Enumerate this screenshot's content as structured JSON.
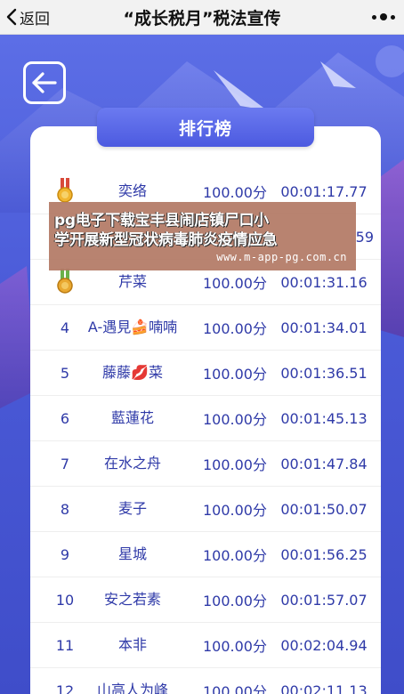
{
  "header": {
    "back_label": "返回",
    "title": "“成长税月”税法宣传"
  },
  "board": {
    "title": "排行榜"
  },
  "rows": [
    {
      "rank": "",
      "medal": "gold-medal-icon",
      "name": "奕络",
      "score": "100.00分",
      "time": "00:01:17.77"
    },
    {
      "rank": "",
      "medal": "silver-medal-icon",
      "name": "",
      "score": "",
      "time": "59"
    },
    {
      "rank": "",
      "medal": "bronze-medal-icon",
      "name": "芹菜",
      "score": "100.00分",
      "time": "00:01:31.16"
    },
    {
      "rank": "4",
      "name": "A-遇見🍰喃喃",
      "score": "100.00分",
      "time": "00:01:34.01"
    },
    {
      "rank": "5",
      "name": "藤藤💋菜",
      "score": "100.00分",
      "time": "00:01:36.51"
    },
    {
      "rank": "6",
      "name": "藍蓮花",
      "score": "100.00分",
      "time": "00:01:45.13"
    },
    {
      "rank": "7",
      "name": "在水之舟",
      "score": "100.00分",
      "time": "00:01:47.84"
    },
    {
      "rank": "8",
      "name": "麦子",
      "score": "100.00分",
      "time": "00:01:50.07"
    },
    {
      "rank": "9",
      "name": "星城",
      "score": "100.00分",
      "time": "00:01:56.25"
    },
    {
      "rank": "10",
      "name": "安之若素",
      "score": "100.00分",
      "time": "00:01:57.07"
    },
    {
      "rank": "11",
      "name": "本非",
      "score": "100.00分",
      "time": "00:02:04.94"
    },
    {
      "rank": "12",
      "name": "山高人为峰",
      "score": "100.00分",
      "time": "00:02:11.13"
    }
  ],
  "watermark": {
    "line1": "pg电子下载宝丰县闹店镇尸口小",
    "line2": "学开展新型冠状病毒肺炎疫情应急",
    "url": "www.m-app-pg.com.cn"
  },
  "colors": {
    "accent": "#4c5ae0",
    "row_text": "#2f3aa8",
    "background": "#4b5bd8"
  }
}
